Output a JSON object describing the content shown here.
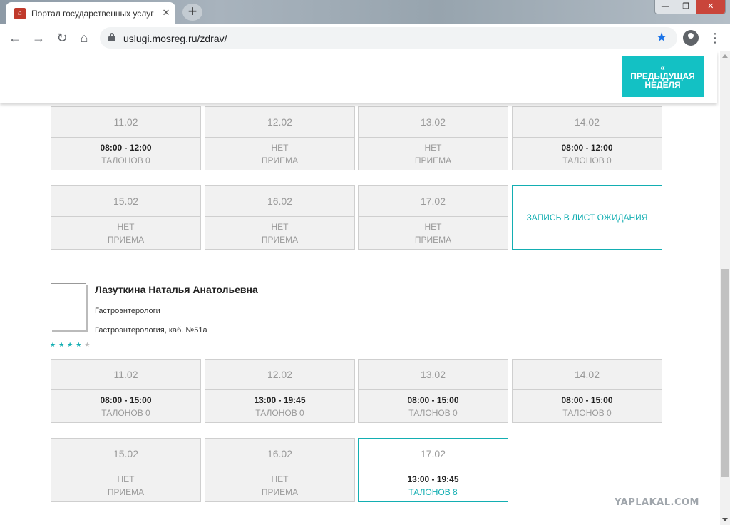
{
  "browser": {
    "tab_title": "Портал государственных услуг",
    "tab_close": "✕",
    "new_tab": "+",
    "url": "uslugi.mosreg.ru/zdrav/",
    "win_min": "—",
    "win_max": "❐",
    "win_close": "✕"
  },
  "header": {
    "prev_week_arrow": "«",
    "prev_week_label": "ПРЕДЫДУЩАЯ НЕДЕЛЯ"
  },
  "schedule1": {
    "row1": [
      {
        "date": "11.02",
        "time": "08:00 - 12:00",
        "sub": "ТАЛОНОВ 0"
      },
      {
        "date": "12.02",
        "time": "НЕТ",
        "sub": "ПРИЕМА"
      },
      {
        "date": "13.02",
        "time": "НЕТ",
        "sub": "ПРИЕМА"
      },
      {
        "date": "14.02",
        "time": "08:00 - 12:00",
        "sub": "ТАЛОНОВ 0"
      }
    ],
    "row2": [
      {
        "date": "15.02",
        "time": "НЕТ",
        "sub": "ПРИЕМА"
      },
      {
        "date": "16.02",
        "time": "НЕТ",
        "sub": "ПРИЕМА"
      },
      {
        "date": "17.02",
        "time": "НЕТ",
        "sub": "ПРИЕМА"
      }
    ],
    "waitlist": "ЗАПИСЬ В ЛИСТ ОЖИДАНИЯ"
  },
  "doctor": {
    "name": "Лазуткина Наталья Анатольевна",
    "specialty": "Гастроэнтерологи",
    "room": "Гастроэнтерология, каб. №51а",
    "rating": 4,
    "rating_max": 5
  },
  "schedule2": {
    "row1": [
      {
        "date": "11.02",
        "time": "08:00 - 15:00",
        "sub": "ТАЛОНОВ 0"
      },
      {
        "date": "12.02",
        "time": "13:00 - 19:45",
        "sub": "ТАЛОНОВ 0"
      },
      {
        "date": "13.02",
        "time": "08:00 - 15:00",
        "sub": "ТАЛОНОВ 0"
      },
      {
        "date": "14.02",
        "time": "08:00 - 15:00",
        "sub": "ТАЛОНОВ 0"
      }
    ],
    "row2": [
      {
        "date": "15.02",
        "time": "НЕТ",
        "sub": "ПРИЕМА"
      },
      {
        "date": "16.02",
        "time": "НЕТ",
        "sub": "ПРИЕМА"
      },
      {
        "date": "17.02",
        "time": "13:00 - 19:45",
        "sub": "ТАЛОНОВ 8"
      }
    ]
  },
  "watermark": "YAPLAKAL.COM",
  "colors": {
    "accent": "#13c1c4",
    "border_active": "#13aeb2"
  }
}
